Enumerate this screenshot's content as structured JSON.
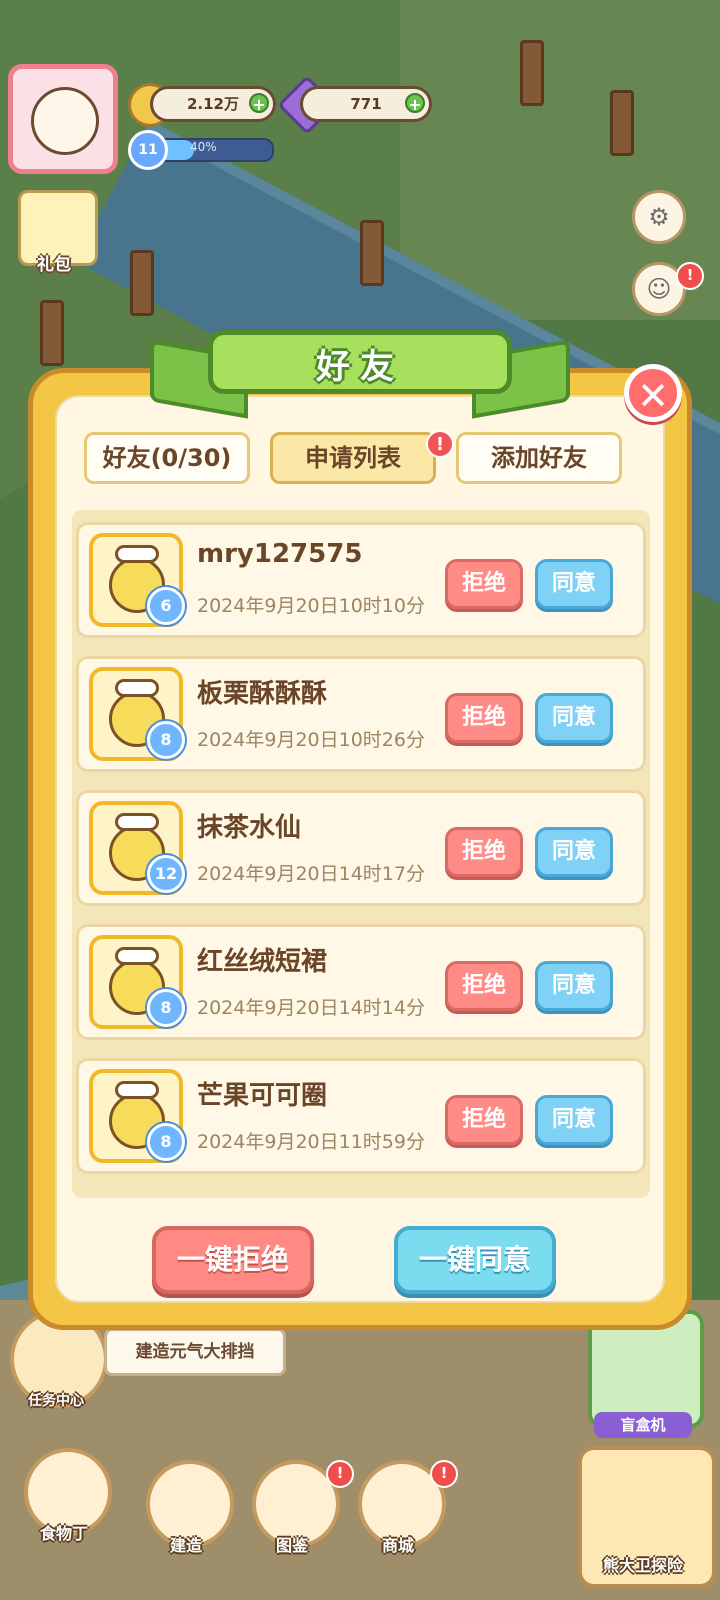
{
  "hud": {
    "coins": "2.12万",
    "gems": "771",
    "level": "11",
    "level_progress_pct": "40%",
    "level_progress": 0.4,
    "gift_label": "礼包",
    "plus_symbol": "+",
    "settings_icon": "gear-icon",
    "chat_badge": "!"
  },
  "dialog": {
    "title": "好友",
    "close_symbol": "✕",
    "tabs": [
      {
        "label": "好友(0/30)"
      },
      {
        "label": "申请列表"
      },
      {
        "label": "添加好友"
      }
    ],
    "tab_badge": "!",
    "requests": [
      {
        "name": "mry127575",
        "time": "2024年9月20日10时10分",
        "level": "6",
        "reject": "拒绝",
        "accept": "同意"
      },
      {
        "name": "板栗酥酥酥",
        "time": "2024年9月20日10时26分",
        "level": "8",
        "reject": "拒绝",
        "accept": "同意"
      },
      {
        "name": "抹茶水仙",
        "time": "2024年9月20日14时17分",
        "level": "12",
        "reject": "拒绝",
        "accept": "同意"
      },
      {
        "name": "红丝绒短裙",
        "time": "2024年9月20日14时14分",
        "level": "8",
        "reject": "拒绝",
        "accept": "同意"
      },
      {
        "name": "芒果可可圈",
        "time": "2024年9月20日11时59分",
        "level": "8",
        "reject": "拒绝",
        "accept": "同意"
      }
    ],
    "reject_all": "一键拒绝",
    "accept_all": "一键同意"
  },
  "bottom": {
    "task_tip": "建造元气大排挡",
    "task_center": "任务中心",
    "blind_box": "盲盒机",
    "explore": "熊大卫探险",
    "nav": [
      {
        "label": "食物丁"
      },
      {
        "label": "建造"
      },
      {
        "label": "图鉴"
      },
      {
        "label": "商城"
      }
    ],
    "nav_badge": "!"
  },
  "colors": {
    "dialog_frame": "#f4c646",
    "title_ribbon": "#a6e05c",
    "reject": "#ff8b86",
    "accept": "#7fd2f5",
    "text_brown": "#6b4528"
  }
}
